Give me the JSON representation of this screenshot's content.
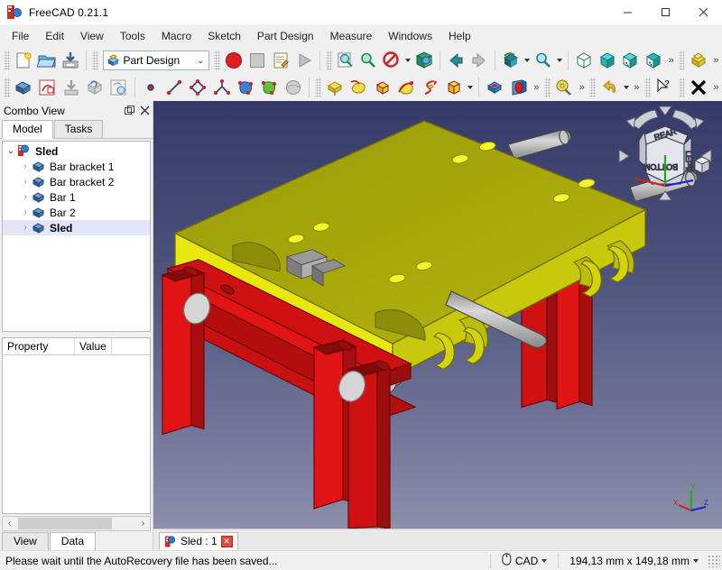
{
  "window": {
    "title": "FreeCAD 0.21.1",
    "app_icon": "freecad-logo-icon",
    "minimize": "minimize-icon",
    "maximize": "maximize-icon",
    "close": "close-icon"
  },
  "menubar": {
    "items": [
      {
        "label": "File"
      },
      {
        "label": "Edit"
      },
      {
        "label": "View"
      },
      {
        "label": "Tools"
      },
      {
        "label": "Macro"
      },
      {
        "label": "Sketch"
      },
      {
        "label": "Part Design"
      },
      {
        "label": "Measure"
      },
      {
        "label": "Windows"
      },
      {
        "label": "Help"
      }
    ]
  },
  "toolbars": {
    "file": {
      "buttons": [
        {
          "name": "new-document-icon",
          "title": "New"
        },
        {
          "name": "open-document-icon",
          "title": "Open"
        },
        {
          "name": "save-document-icon",
          "title": "Save"
        }
      ]
    },
    "workbench": {
      "selected": "Part Design",
      "icon": "part-design-workbench-icon",
      "options": [
        "Part Design"
      ]
    },
    "macro": {
      "buttons": [
        {
          "name": "macro-record-icon",
          "title": "Macro recording"
        },
        {
          "name": "macro-stop-icon",
          "title": "Stop macro recording"
        },
        {
          "name": "macro-edit-icon",
          "title": "Macros"
        },
        {
          "name": "macro-execute-icon",
          "title": "Execute macro"
        }
      ]
    },
    "view_basic": {
      "buttons": [
        {
          "name": "fit-all-icon",
          "title": "Fit all"
        },
        {
          "name": "fit-selection-icon",
          "title": "Fit selection"
        },
        {
          "name": "draw-style-icon",
          "title": "Draw style"
        },
        {
          "name": "axonometric-view-icon",
          "title": "Axonometric"
        }
      ]
    },
    "view_nav": {
      "buttons": [
        {
          "name": "previous-view-icon",
          "title": "Previous view"
        },
        {
          "name": "next-view-icon",
          "title": "Next view"
        },
        {
          "name": "isometric-view-icon",
          "title": "Isometric"
        },
        {
          "name": "zoom-icon",
          "title": "Zoom"
        },
        {
          "name": "front-view-icon",
          "title": "Front"
        },
        {
          "name": "top-view-icon",
          "title": "Top"
        },
        {
          "name": "rear-view-icon",
          "title": "Rear"
        },
        {
          "name": "bottom-view-icon",
          "title": "Bottom"
        }
      ]
    },
    "structure": {
      "buttons": [
        {
          "name": "create-part-icon",
          "title": "Create part"
        }
      ]
    },
    "partdesign_helper": {
      "buttons": [
        {
          "name": "create-body-icon",
          "title": "Create body"
        },
        {
          "name": "create-sketch-icon",
          "title": "Create sketch"
        },
        {
          "name": "attach-sketch-icon",
          "title": "Attach sketch"
        },
        {
          "name": "shape-binder-icon",
          "title": "Create shape binder"
        },
        {
          "name": "sub-object-binder-icon",
          "title": "Create sub-object shape binder"
        }
      ]
    },
    "sketcher_geometry": {
      "buttons": [
        {
          "name": "sketch-point-icon",
          "title": "Point"
        },
        {
          "name": "sketch-line-icon",
          "title": "Line"
        },
        {
          "name": "sketch-polyline-icon",
          "title": "Polyline"
        },
        {
          "name": "sketch-arc-icon",
          "title": "Arc"
        },
        {
          "name": "sketch-surface-blue-icon",
          "title": "Surface"
        },
        {
          "name": "sketch-surface-green-icon",
          "title": "Surface green"
        },
        {
          "name": "sketch-sphere-icon",
          "title": "Sphere"
        }
      ]
    },
    "partdesign_additive": {
      "buttons": [
        {
          "name": "pad-icon",
          "title": "Pad"
        },
        {
          "name": "revolution-icon",
          "title": "Revolution"
        },
        {
          "name": "additive-loft-icon",
          "title": "Additive loft"
        },
        {
          "name": "additive-pipe-icon",
          "title": "Additive pipe"
        },
        {
          "name": "additive-helix-icon",
          "title": "Additive helix"
        },
        {
          "name": "additive-primitive-icon",
          "title": "Additive primitive"
        }
      ]
    },
    "partdesign_subtractive": {
      "buttons": [
        {
          "name": "pocket-icon",
          "title": "Pocket"
        },
        {
          "name": "hole-icon",
          "title": "Hole"
        }
      ]
    },
    "measure": {
      "buttons": [
        {
          "name": "measure-icon",
          "title": "Measure"
        }
      ]
    },
    "edit": {
      "buttons": [
        {
          "name": "undo-icon",
          "title": "Undo"
        }
      ]
    },
    "whatsthis": {
      "buttons": [
        {
          "name": "whats-this-icon",
          "title": "What's this?"
        }
      ]
    },
    "close": {
      "buttons": [
        {
          "name": "close-x-icon",
          "title": "Close"
        }
      ]
    },
    "overflow_label": "»"
  },
  "combo_view": {
    "title": "Combo View",
    "float_button": "undock-icon",
    "close_button": "close-icon",
    "tabs": [
      {
        "label": "Model",
        "active": true
      },
      {
        "label": "Tasks",
        "active": false
      }
    ],
    "tree": [
      {
        "label": "Sled",
        "level": 0,
        "expanded": true,
        "icon": "freecad-document-icon",
        "selected": false
      },
      {
        "label": "Bar bracket 1",
        "level": 1,
        "expanded": false,
        "icon": "body-icon",
        "selected": false
      },
      {
        "label": "Bar bracket 2",
        "level": 1,
        "expanded": false,
        "icon": "body-icon",
        "selected": false
      },
      {
        "label": "Bar 1",
        "level": 1,
        "expanded": false,
        "icon": "body-icon",
        "selected": false
      },
      {
        "label": "Bar 2",
        "level": 1,
        "expanded": false,
        "icon": "body-icon",
        "selected": false
      },
      {
        "label": "Sled",
        "level": 1,
        "expanded": false,
        "icon": "body-icon",
        "selected": true
      }
    ],
    "property_editor": {
      "columns": [
        "Property",
        "Value"
      ],
      "rows": []
    },
    "bottom_tabs": [
      {
        "label": "View",
        "active": false
      },
      {
        "label": "Data",
        "active": true
      }
    ]
  },
  "view3d": {
    "navigation_cube": {
      "faces": [
        "REAR",
        "BOTTOM",
        "LEFT"
      ]
    },
    "axis_labels": [
      "X",
      "Y",
      "Z"
    ],
    "colors": {
      "background_top": "#363a68",
      "background_bottom": "#8c8fab",
      "sled_yellow": "#e8e800",
      "sled_yellow_shade": "#8f8f14",
      "bracket_red": "#e81414",
      "bracket_red_shade": "#a00d0d",
      "rod_gray": "#b6b6b6",
      "axis_x": "#cc2222",
      "axis_y": "#22aa22",
      "axis_z": "#2222cc"
    }
  },
  "document_tabs": [
    {
      "label": "Sled : 1",
      "icon": "freecad-document-icon",
      "close": "close-tab-icon",
      "active": true
    }
  ],
  "statusbar": {
    "message": "Please wait until the AutoRecovery file has been saved...",
    "navigation_style": "CAD",
    "navigation_icon": "mouse-icon",
    "dimensions": "194,13 mm x 149,18 mm"
  }
}
